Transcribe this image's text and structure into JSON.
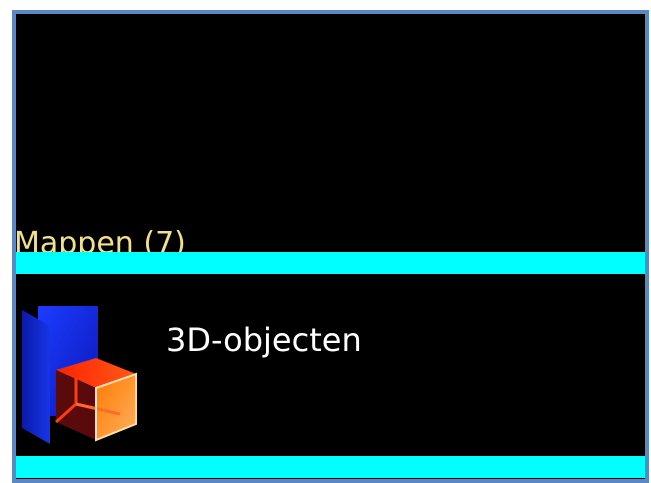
{
  "group": {
    "header": "Mappen (7)",
    "clipped_text": ":"
  },
  "folders": [
    {
      "label": "3D-objecten",
      "icon": "3d-objects-folder-icon"
    }
  ],
  "colors": {
    "background": "#000000",
    "highlight": "#00ffff",
    "header_text": "#f0e28a",
    "item_text": "#ffffff",
    "frame_border": "#5b87c4"
  }
}
